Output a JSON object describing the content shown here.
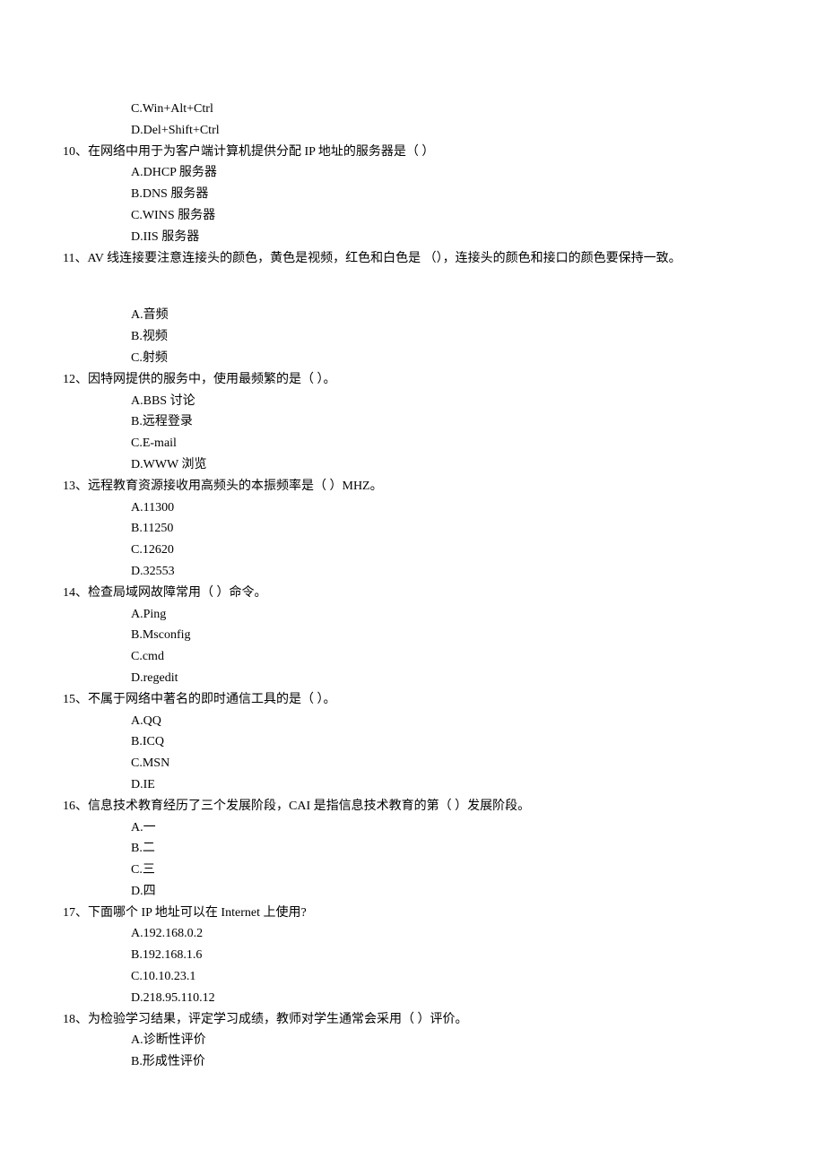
{
  "q9": {
    "opts": {
      "c": "C.Win+Alt+Ctrl",
      "d": "D.Del+Shift+Ctrl"
    }
  },
  "q10": {
    "text": "10、在网络中用于为客户端计算机提供分配 IP 地址的服务器是（        ）",
    "opts": {
      "a": "A.DHCP 服务器",
      "b": "B.DNS 服务器",
      "c": "C.WINS 服务器",
      "d": "D.IIS 服务器"
    }
  },
  "q11": {
    "text": "11、AV 线连接要注意连接头的颜色，黄色是视频，红色和白色是    （），连接头的颜色和接口的颜色要保持一致。",
    "opts": {
      "a": "A.音频",
      "b": "B.视频",
      "c": "C.射频"
    }
  },
  "q12": {
    "text": "12、因特网提供的服务中，使用最频繁的是（        ）。",
    "opts": {
      "a": "A.BBS 讨论",
      "b": "B.远程登录",
      "c": "C.E-mail",
      "d": "D.WWW 浏览"
    }
  },
  "q13": {
    "text": "13、远程教育资源接收用高频头的本振频率是（       ）MHZ。",
    "opts": {
      "a": "A.11300",
      "b": "B.11250",
      "c": "C.12620",
      "d": "D.32553"
    }
  },
  "q14": {
    "text": "14、检查局域网故障常用（                ）命令。",
    "opts": {
      "a": "A.Ping",
      "b": "B.Msconfig",
      "c": "C.cmd",
      "d": "D.regedit"
    }
  },
  "q15": {
    "text": "15、不属于网络中著名的即时通信工具的是（              ）。",
    "opts": {
      "a": "A.QQ",
      "b": "B.ICQ",
      "c": "C.MSN",
      "d": "D.IE"
    }
  },
  "q16": {
    "text": "16、信息技术教育经历了三个发展阶段，CAI 是指信息技术教育的第（     ）发展阶段。",
    "opts": {
      "a": "A.一",
      "b": "B.二",
      "c": "C.三",
      "d": "D.四"
    }
  },
  "q17": {
    "text": "17、下面哪个 IP 地址可以在 Internet 上使用?",
    "opts": {
      "a": "A.192.168.0.2",
      "b": "B.192.168.1.6",
      "c": "C.10.10.23.1",
      "d": "D.218.95.110.12"
    }
  },
  "q18": {
    "text": "18、为检验学习结果，评定学习成绩，教师对学生通常会采用（     ）评价。",
    "opts": {
      "a": "A.诊断性评价",
      "b": "B.形成性评价"
    }
  }
}
